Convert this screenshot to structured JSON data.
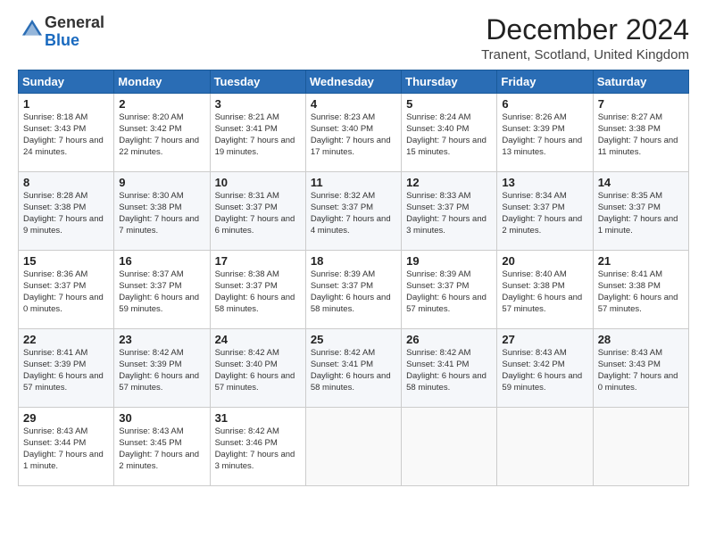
{
  "header": {
    "logo_general": "General",
    "logo_blue": "Blue",
    "month_title": "December 2024",
    "location": "Tranent, Scotland, United Kingdom"
  },
  "days_of_week": [
    "Sunday",
    "Monday",
    "Tuesday",
    "Wednesday",
    "Thursday",
    "Friday",
    "Saturday"
  ],
  "weeks": [
    [
      {
        "day": "1",
        "rise": "Sunrise: 8:18 AM",
        "set": "Sunset: 3:43 PM",
        "daylight": "Daylight: 7 hours and 24 minutes."
      },
      {
        "day": "2",
        "rise": "Sunrise: 8:20 AM",
        "set": "Sunset: 3:42 PM",
        "daylight": "Daylight: 7 hours and 22 minutes."
      },
      {
        "day": "3",
        "rise": "Sunrise: 8:21 AM",
        "set": "Sunset: 3:41 PM",
        "daylight": "Daylight: 7 hours and 19 minutes."
      },
      {
        "day": "4",
        "rise": "Sunrise: 8:23 AM",
        "set": "Sunset: 3:40 PM",
        "daylight": "Daylight: 7 hours and 17 minutes."
      },
      {
        "day": "5",
        "rise": "Sunrise: 8:24 AM",
        "set": "Sunset: 3:40 PM",
        "daylight": "Daylight: 7 hours and 15 minutes."
      },
      {
        "day": "6",
        "rise": "Sunrise: 8:26 AM",
        "set": "Sunset: 3:39 PM",
        "daylight": "Daylight: 7 hours and 13 minutes."
      },
      {
        "day": "7",
        "rise": "Sunrise: 8:27 AM",
        "set": "Sunset: 3:38 PM",
        "daylight": "Daylight: 7 hours and 11 minutes."
      }
    ],
    [
      {
        "day": "8",
        "rise": "Sunrise: 8:28 AM",
        "set": "Sunset: 3:38 PM",
        "daylight": "Daylight: 7 hours and 9 minutes."
      },
      {
        "day": "9",
        "rise": "Sunrise: 8:30 AM",
        "set": "Sunset: 3:38 PM",
        "daylight": "Daylight: 7 hours and 7 minutes."
      },
      {
        "day": "10",
        "rise": "Sunrise: 8:31 AM",
        "set": "Sunset: 3:37 PM",
        "daylight": "Daylight: 7 hours and 6 minutes."
      },
      {
        "day": "11",
        "rise": "Sunrise: 8:32 AM",
        "set": "Sunset: 3:37 PM",
        "daylight": "Daylight: 7 hours and 4 minutes."
      },
      {
        "day": "12",
        "rise": "Sunrise: 8:33 AM",
        "set": "Sunset: 3:37 PM",
        "daylight": "Daylight: 7 hours and 3 minutes."
      },
      {
        "day": "13",
        "rise": "Sunrise: 8:34 AM",
        "set": "Sunset: 3:37 PM",
        "daylight": "Daylight: 7 hours and 2 minutes."
      },
      {
        "day": "14",
        "rise": "Sunrise: 8:35 AM",
        "set": "Sunset: 3:37 PM",
        "daylight": "Daylight: 7 hours and 1 minute."
      }
    ],
    [
      {
        "day": "15",
        "rise": "Sunrise: 8:36 AM",
        "set": "Sunset: 3:37 PM",
        "daylight": "Daylight: 7 hours and 0 minutes."
      },
      {
        "day": "16",
        "rise": "Sunrise: 8:37 AM",
        "set": "Sunset: 3:37 PM",
        "daylight": "Daylight: 6 hours and 59 minutes."
      },
      {
        "day": "17",
        "rise": "Sunrise: 8:38 AM",
        "set": "Sunset: 3:37 PM",
        "daylight": "Daylight: 6 hours and 58 minutes."
      },
      {
        "day": "18",
        "rise": "Sunrise: 8:39 AM",
        "set": "Sunset: 3:37 PM",
        "daylight": "Daylight: 6 hours and 58 minutes."
      },
      {
        "day": "19",
        "rise": "Sunrise: 8:39 AM",
        "set": "Sunset: 3:37 PM",
        "daylight": "Daylight: 6 hours and 57 minutes."
      },
      {
        "day": "20",
        "rise": "Sunrise: 8:40 AM",
        "set": "Sunset: 3:38 PM",
        "daylight": "Daylight: 6 hours and 57 minutes."
      },
      {
        "day": "21",
        "rise": "Sunrise: 8:41 AM",
        "set": "Sunset: 3:38 PM",
        "daylight": "Daylight: 6 hours and 57 minutes."
      }
    ],
    [
      {
        "day": "22",
        "rise": "Sunrise: 8:41 AM",
        "set": "Sunset: 3:39 PM",
        "daylight": "Daylight: 6 hours and 57 minutes."
      },
      {
        "day": "23",
        "rise": "Sunrise: 8:42 AM",
        "set": "Sunset: 3:39 PM",
        "daylight": "Daylight: 6 hours and 57 minutes."
      },
      {
        "day": "24",
        "rise": "Sunrise: 8:42 AM",
        "set": "Sunset: 3:40 PM",
        "daylight": "Daylight: 6 hours and 57 minutes."
      },
      {
        "day": "25",
        "rise": "Sunrise: 8:42 AM",
        "set": "Sunset: 3:41 PM",
        "daylight": "Daylight: 6 hours and 58 minutes."
      },
      {
        "day": "26",
        "rise": "Sunrise: 8:42 AM",
        "set": "Sunset: 3:41 PM",
        "daylight": "Daylight: 6 hours and 58 minutes."
      },
      {
        "day": "27",
        "rise": "Sunrise: 8:43 AM",
        "set": "Sunset: 3:42 PM",
        "daylight": "Daylight: 6 hours and 59 minutes."
      },
      {
        "day": "28",
        "rise": "Sunrise: 8:43 AM",
        "set": "Sunset: 3:43 PM",
        "daylight": "Daylight: 7 hours and 0 minutes."
      }
    ],
    [
      {
        "day": "29",
        "rise": "Sunrise: 8:43 AM",
        "set": "Sunset: 3:44 PM",
        "daylight": "Daylight: 7 hours and 1 minute."
      },
      {
        "day": "30",
        "rise": "Sunrise: 8:43 AM",
        "set": "Sunset: 3:45 PM",
        "daylight": "Daylight: 7 hours and 2 minutes."
      },
      {
        "day": "31",
        "rise": "Sunrise: 8:42 AM",
        "set": "Sunset: 3:46 PM",
        "daylight": "Daylight: 7 hours and 3 minutes."
      },
      null,
      null,
      null,
      null
    ]
  ]
}
